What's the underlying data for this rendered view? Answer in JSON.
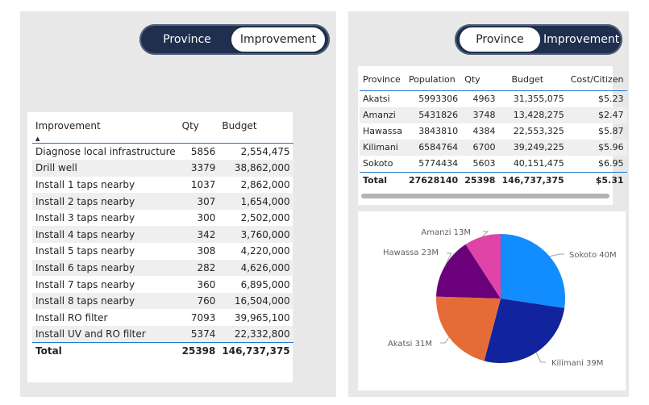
{
  "left_toggle": {
    "options": [
      "Province",
      "Improvement"
    ],
    "selected": "Improvement"
  },
  "right_toggle": {
    "options": [
      "Province",
      "Improvement"
    ],
    "selected": "Province"
  },
  "improvement_table": {
    "headers": {
      "improvement": "Improvement",
      "qty": "Qty",
      "budget": "Budget"
    },
    "sort_indicator": "▲",
    "rows": [
      {
        "improvement": "Diagnose local infrastructure",
        "qty": "5856",
        "budget": "2,554,475"
      },
      {
        "improvement": "Drill well",
        "qty": "3379",
        "budget": "38,862,000"
      },
      {
        "improvement": "Install 1 taps nearby",
        "qty": "1037",
        "budget": "2,862,000"
      },
      {
        "improvement": "Install 2 taps nearby",
        "qty": "307",
        "budget": "1,654,000"
      },
      {
        "improvement": "Install 3 taps nearby",
        "qty": "300",
        "budget": "2,502,000"
      },
      {
        "improvement": "Install 4 taps nearby",
        "qty": "342",
        "budget": "3,760,000"
      },
      {
        "improvement": "Install 5 taps nearby",
        "qty": "308",
        "budget": "4,220,000"
      },
      {
        "improvement": "Install 6 taps nearby",
        "qty": "282",
        "budget": "4,626,000"
      },
      {
        "improvement": "Install 7 taps nearby",
        "qty": "360",
        "budget": "6,895,000"
      },
      {
        "improvement": "Install 8 taps nearby",
        "qty": "760",
        "budget": "16,504,000"
      },
      {
        "improvement": "Install RO filter",
        "qty": "7093",
        "budget": "39,965,100"
      },
      {
        "improvement": "Install UV and RO filter",
        "qty": "5374",
        "budget": "22,332,800"
      }
    ],
    "total": {
      "label": "Total",
      "qty": "25398",
      "budget": "146,737,375"
    }
  },
  "province_table": {
    "headers": {
      "province": "Province",
      "population": "Population",
      "qty": "Qty",
      "budget": "Budget",
      "cost": "Cost/Citizen"
    },
    "rows": [
      {
        "province": "Akatsi",
        "population": "5993306",
        "qty": "4963",
        "budget": "31,355,075",
        "cost": "$5.23"
      },
      {
        "province": "Amanzi",
        "population": "5431826",
        "qty": "3748",
        "budget": "13,428,275",
        "cost": "$2.47"
      },
      {
        "province": "Hawassa",
        "population": "3843810",
        "qty": "4384",
        "budget": "22,553,325",
        "cost": "$5.87"
      },
      {
        "province": "Kilimani",
        "population": "6584764",
        "qty": "6700",
        "budget": "39,249,225",
        "cost": "$5.96"
      },
      {
        "province": "Sokoto",
        "population": "5774434",
        "qty": "5603",
        "budget": "40,151,475",
        "cost": "$6.95"
      }
    ],
    "total": {
      "label": "Total",
      "population": "27628140",
      "qty": "25398",
      "budget": "146,737,375",
      "cost": "$5.31"
    }
  },
  "chart_data": {
    "type": "pie",
    "slices": [
      {
        "name": "Sokoto",
        "value": 40151475,
        "label": "Sokoto 40M",
        "color": "#118DFF"
      },
      {
        "name": "Kilimani",
        "value": 39249225,
        "label": "Kilimani 39M",
        "color": "#12239E"
      },
      {
        "name": "Akatsi",
        "value": 31355075,
        "label": "Akatsi 31M",
        "color": "#E66C37"
      },
      {
        "name": "Hawassa",
        "value": 22553325,
        "label": "Hawassa 23M",
        "color": "#6B007B"
      },
      {
        "name": "Amanzi",
        "value": 13428275,
        "label": "Amanzi 13M",
        "color": "#E044A7"
      }
    ]
  }
}
